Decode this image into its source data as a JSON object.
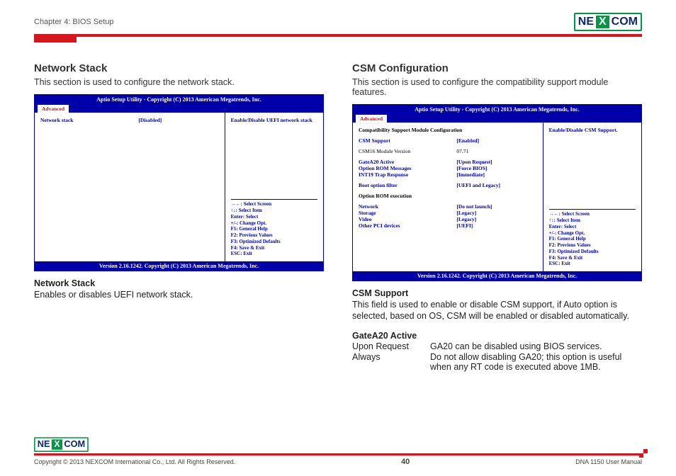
{
  "header": {
    "chapter": "Chapter 4: BIOS Setup",
    "logo": {
      "ne": "NE",
      "x": "X",
      "com": "COM"
    }
  },
  "left": {
    "title": "Network Stack",
    "desc": "This section is used to configure the network stack.",
    "bios": {
      "title": "Aptio Setup Utility - Copyright (C) 2013 American Megatrends, Inc.",
      "tab": "Advanced",
      "rows": [
        {
          "lbl": "Network stack",
          "val": "[Disabled]"
        }
      ],
      "rightTop": "Enable/Disable UEFI network stack",
      "footer": "Version 2.16.1242. Copyright (C) 2013 American Megatrends, Inc."
    },
    "sub1": {
      "h": "Network Stack",
      "p": "Enables or disables UEFI network stack."
    }
  },
  "right": {
    "title": "CSM Configuration",
    "desc": "This section is used to configure the compatibility support module features.",
    "bios": {
      "title": "Aptio Setup Utility - Copyright (C) 2013 American Megatrends, Inc.",
      "tab": "Advanced",
      "heading1": "Compatibility Support Module Configuration",
      "r1": {
        "lbl": "CSM Support",
        "val": "[Enabled]"
      },
      "r2": {
        "lbl": "CSM16 Module Version",
        "val": "07.71"
      },
      "r3": {
        "lbl": "GateA20 Active",
        "val": "[Upon Request]"
      },
      "r4": {
        "lbl": "Option ROM Messages",
        "val": "[Force BIOS]"
      },
      "r5": {
        "lbl": "INT19 Trap Response",
        "val": "[Immediate]"
      },
      "r6": {
        "lbl": "Boot option filter",
        "val": "[UEFI and Legacy]"
      },
      "heading2": "Option ROM execution",
      "r7": {
        "lbl": "Network",
        "val": "[Do not launch]"
      },
      "r8": {
        "lbl": "Storage",
        "val": "[Legacy]"
      },
      "r9": {
        "lbl": "Video",
        "val": "[Legacy]"
      },
      "r10": {
        "lbl": "Other PCI devices",
        "val": "[UEFI]"
      },
      "rightTop": "Enable/Disable CSM Support.",
      "footer": "Version 2.16.1242. Copyright (C) 2013 American Megatrends, Inc."
    },
    "sub1": {
      "h": "CSM Support",
      "p": "This field is used to enable or disable CSM support, if Auto option is selected, based on OS, CSM will be enabled or disabled automatically."
    },
    "sub2": {
      "h": "GateA20 Active",
      "kv1": {
        "k": "Upon Request",
        "v": "GA20 can be disabled using BIOS services."
      },
      "kv2": {
        "k": "Always",
        "v": "Do not allow disabling GA20; this option is useful when any RT code is executed above 1MB."
      }
    }
  },
  "help": {
    "l1": "→←: Select Screen",
    "l2": "↑↓: Select Item",
    "l3": "Enter: Select",
    "l4": "+/-: Change Opt.",
    "l5": "F1: General Help",
    "l6": "F2: Previous Values",
    "l7": "F3: Optimized Defaults",
    "l8": "F4: Save & Exit",
    "l9": "ESC: Exit"
  },
  "footer": {
    "copyright": "Copyright © 2013 NEXCOM International Co., Ltd. All Rights Reserved.",
    "page": "40",
    "manual": "DNA 1150 User Manual"
  }
}
